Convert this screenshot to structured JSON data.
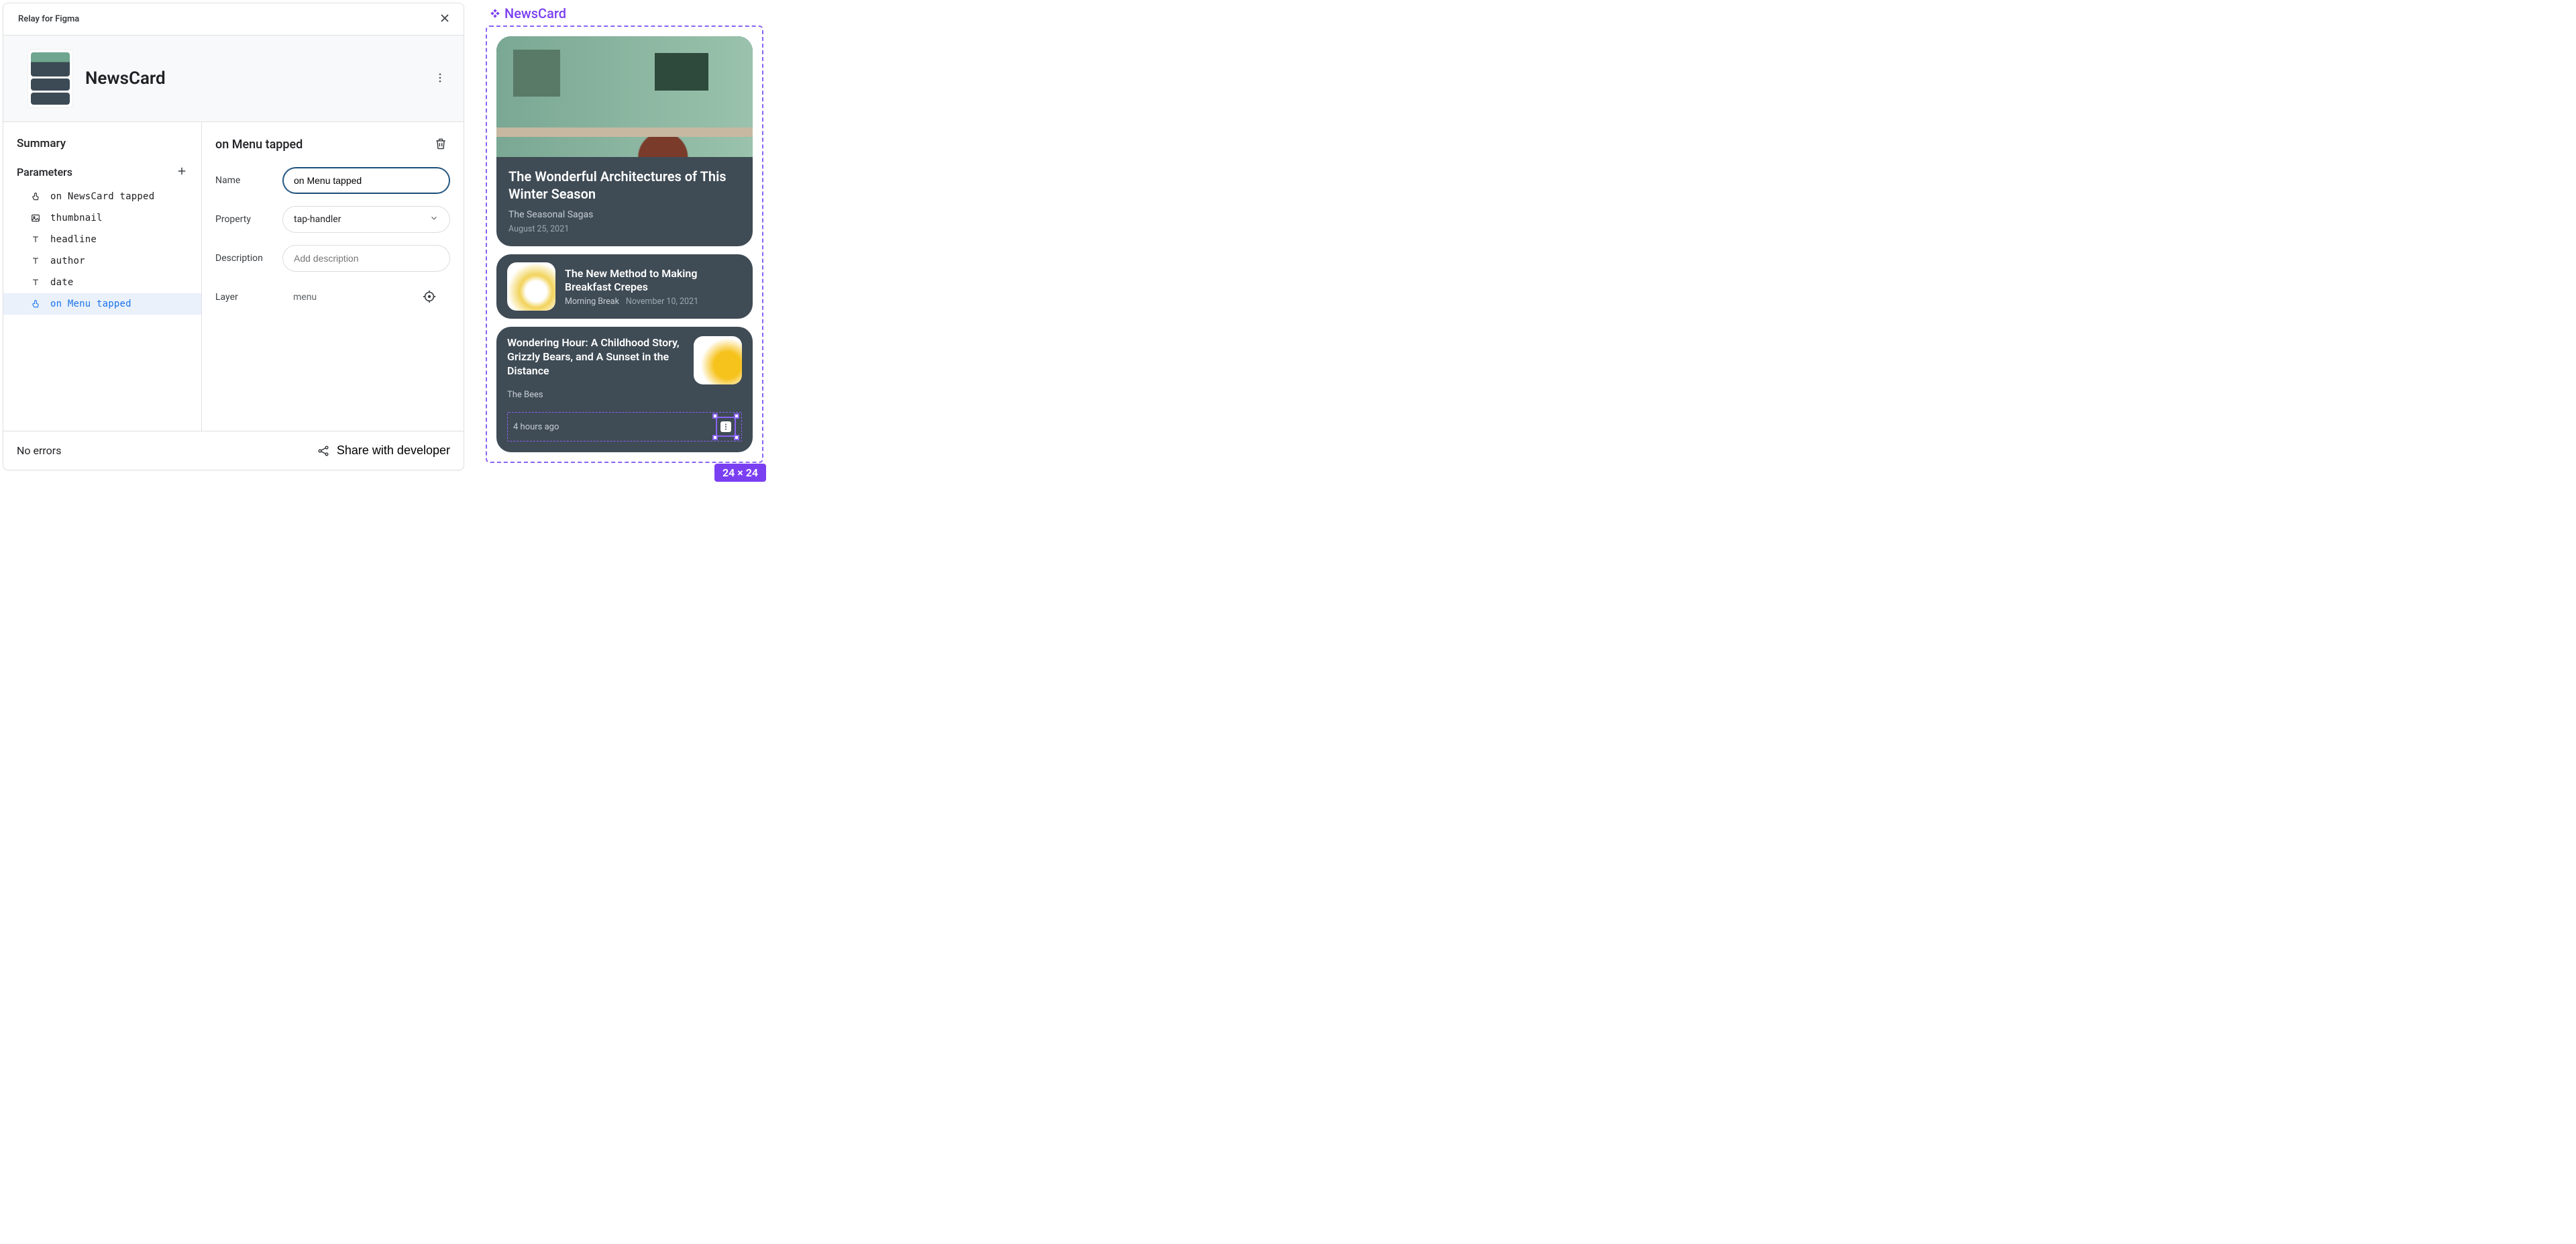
{
  "plugin": {
    "brand": "Relay for Figma",
    "component_title": "NewsCard",
    "summary_heading": "Summary",
    "parameters_heading": "Parameters",
    "params": [
      {
        "icon": "tap",
        "label": "on NewsCard tapped"
      },
      {
        "icon": "image",
        "label": "thumbnail"
      },
      {
        "icon": "text",
        "label": "headline"
      },
      {
        "icon": "text",
        "label": "author"
      },
      {
        "icon": "text",
        "label": "date"
      },
      {
        "icon": "tap",
        "label": "on Menu tapped",
        "selected": true
      }
    ],
    "detail": {
      "title": "on Menu tapped",
      "fields": {
        "name_label": "Name",
        "name_value": "on Menu tapped",
        "property_label": "Property",
        "property_value": "tap-handler",
        "description_label": "Description",
        "description_placeholder": "Add description",
        "layer_label": "Layer",
        "layer_value": "menu"
      }
    },
    "footer": {
      "status": "No errors",
      "share": "Share with developer"
    }
  },
  "canvas": {
    "frame_name": "NewsCard",
    "size_badge": "24 × 24",
    "cards": {
      "hero": {
        "headline": "The Wonderful Architectures of This Winter Season",
        "author": "The Seasonal Sagas",
        "date": "August 25, 2021"
      },
      "row": {
        "headline": "The New Method to Making Breakfast Crepes",
        "author": "Morning Break",
        "date": "November 10, 2021"
      },
      "col": {
        "headline": "Wondering Hour: A Childhood Story, Grizzly Bears, and A Sunset in the Distance",
        "author": "The Bees",
        "date": "4 hours ago"
      }
    }
  }
}
